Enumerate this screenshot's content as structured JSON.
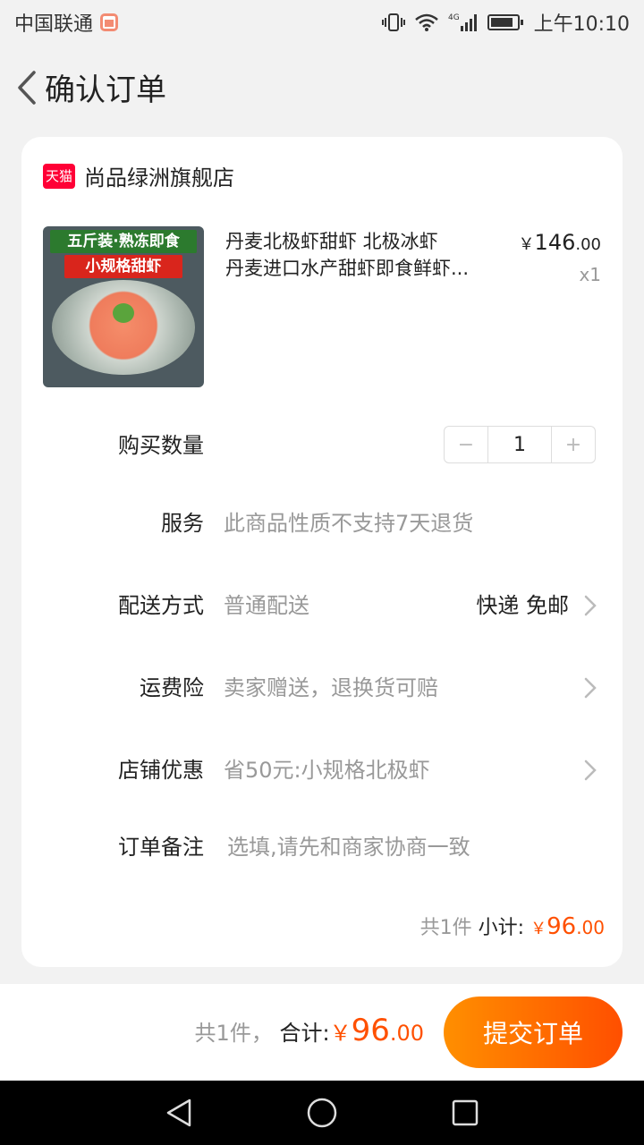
{
  "status_bar": {
    "carrier": "中国联通",
    "network": "4G",
    "time": "上午10:10"
  },
  "nav": {
    "title": "确认订单"
  },
  "shop": {
    "badge": "天猫",
    "name": "尚品绿洲旗舰店"
  },
  "product": {
    "image_banner_1": "五斤装·熟冻即食",
    "image_banner_2": "小规格甜虾",
    "title_line1": "丹麦北极虾甜虾 北极冰虾",
    "title_line2": "丹麦进口水产甜虾即食鲜虾...",
    "price_currency": "￥",
    "price_int": "146",
    "price_dec": ".00",
    "quantity_label": "x1"
  },
  "rows": {
    "quantity_label": "购买数量",
    "quantity_value": "1",
    "minus": "−",
    "plus": "+",
    "service_label": "服务",
    "service_value": "此商品性质不支持7天退货",
    "delivery_label": "配送方式",
    "delivery_value": "普通配送",
    "delivery_right": "快递 免邮",
    "insurance_label": "运费险",
    "insurance_value": "卖家赠送，退换货可赔",
    "discount_label": "店铺优惠",
    "discount_value": "省50元:小规格北极虾",
    "note_label": "订单备注",
    "note_placeholder": "选填,请先和商家协商一致"
  },
  "subtotal": {
    "count": "共1件",
    "label": "小计:",
    "currency": "￥",
    "int": "96",
    "dec": ".00"
  },
  "bottom_bar": {
    "count": "共1件，",
    "label": "合计:",
    "currency": "￥",
    "int": "96",
    "dec": ".00",
    "submit": "提交订单"
  },
  "colors": {
    "accent": "#ff5000",
    "tmall": "#ff0036",
    "background": "#f2f2f2"
  }
}
